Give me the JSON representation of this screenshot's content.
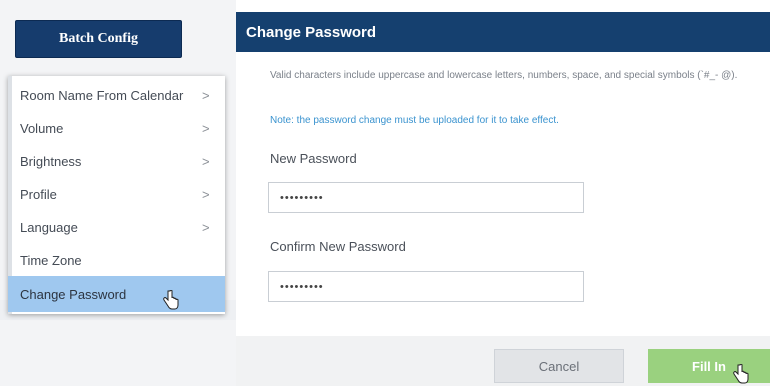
{
  "left_panel": {
    "batch_button_label": "Batch Config",
    "menu": [
      {
        "label": "Room Name From Calendar",
        "has_submenu": true
      },
      {
        "label": "Volume",
        "has_submenu": true
      },
      {
        "label": "Brightness",
        "has_submenu": true
      },
      {
        "label": "Profile",
        "has_submenu": true
      },
      {
        "label": "Language",
        "has_submenu": true
      },
      {
        "label": "Time Zone",
        "has_submenu": false
      },
      {
        "label": "Change Password",
        "has_submenu": false,
        "active": true
      }
    ],
    "chevron": ">"
  },
  "dialog": {
    "title": "Change Password",
    "description": "Valid characters include uppercase and lowercase letters, numbers, space, and special symbols (`#_- @).",
    "note": "Note: the password change must be uploaded for it to take effect.",
    "new_password_label": "New Password",
    "new_password_value": "•••••••••",
    "confirm_password_label": "Confirm New Password",
    "confirm_password_value": "•••••••••",
    "cancel_label": "Cancel",
    "fill_in_label": "Fill In"
  },
  "colors": {
    "header_bg": "#15406f",
    "active_item": "#9fc8ef",
    "note_text": "#3a93cf",
    "fill_in_button": "#9ad17f"
  }
}
